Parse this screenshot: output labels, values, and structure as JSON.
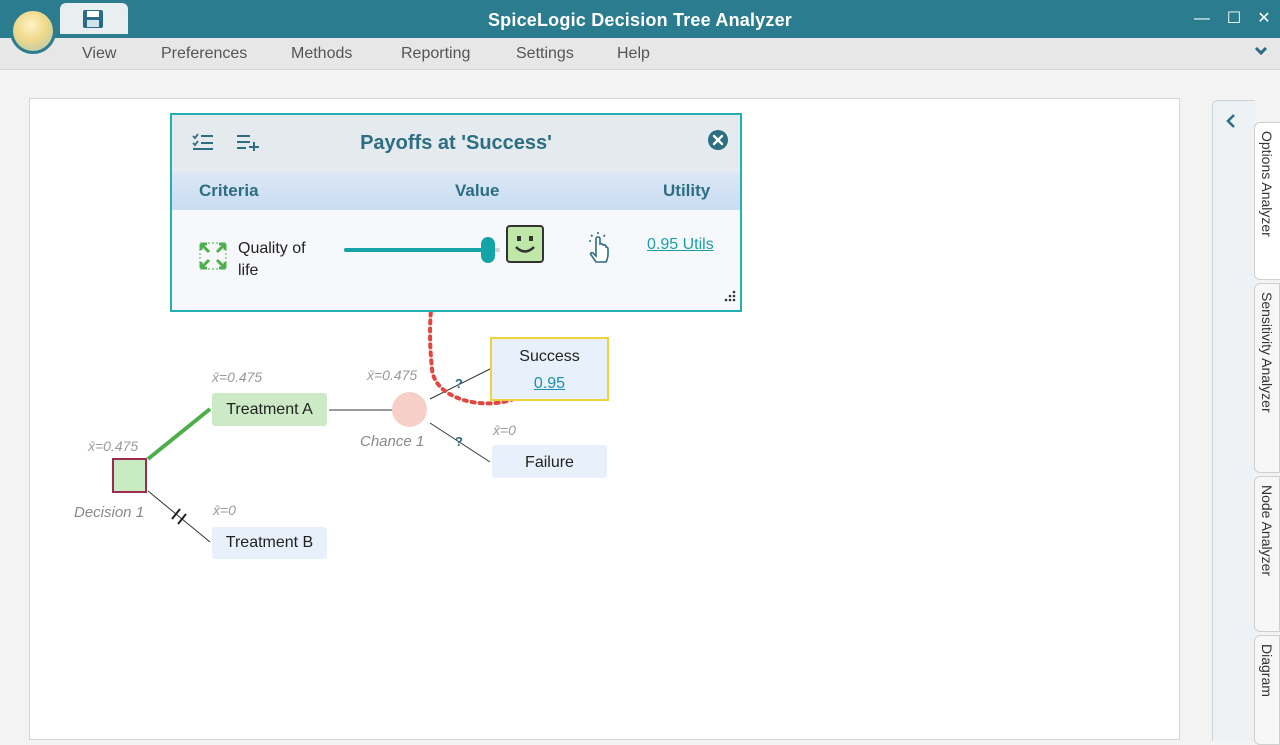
{
  "app": {
    "title": "SpiceLogic Decision Tree Analyzer"
  },
  "window_controls": {
    "minimize": "—",
    "maximize": "☐",
    "close": "✕"
  },
  "menu": [
    "View",
    "Preferences",
    "Methods",
    "Reporting",
    "Settings",
    "Help"
  ],
  "side_tabs": [
    "Options Analyzer",
    "Sensitivity Analyzer",
    "Node Analyzer",
    "Diagram"
  ],
  "payoff": {
    "title": "Payoffs at 'Success'",
    "columns": {
      "criteria": "Criteria",
      "value": "Value",
      "utility": "Utility"
    },
    "row": {
      "criteria": "Quality of life",
      "slider_fraction": 0.92,
      "utility": "0.95 Utils"
    }
  },
  "tree": {
    "decision": {
      "caption": "Decision 1",
      "ev": "x̄=0.475"
    },
    "treatment_a": {
      "label": "Treatment A",
      "ev": "x̄=0.475"
    },
    "treatment_b": {
      "label": "Treatment B",
      "ev": "x̄=0"
    },
    "chance": {
      "caption": "Chance 1",
      "ev": "x̄=0.475"
    },
    "success": {
      "label": "Success",
      "value": "0.95"
    },
    "failure": {
      "label": "Failure",
      "ev": "x̄=0"
    },
    "prob_marker": "?"
  },
  "colors": {
    "titlebar": "#2b7c8e",
    "accent": "#23b0b5",
    "decision_border": "#9b2c4f",
    "decision_fill": "#c8ebc2",
    "treatment_a_fill": "#cdeac6",
    "leaf_fill": "#e8f1fb",
    "success_border": "#f2d23c",
    "chance_fill": "#f6cfc8",
    "arrow": "#e2463f"
  }
}
